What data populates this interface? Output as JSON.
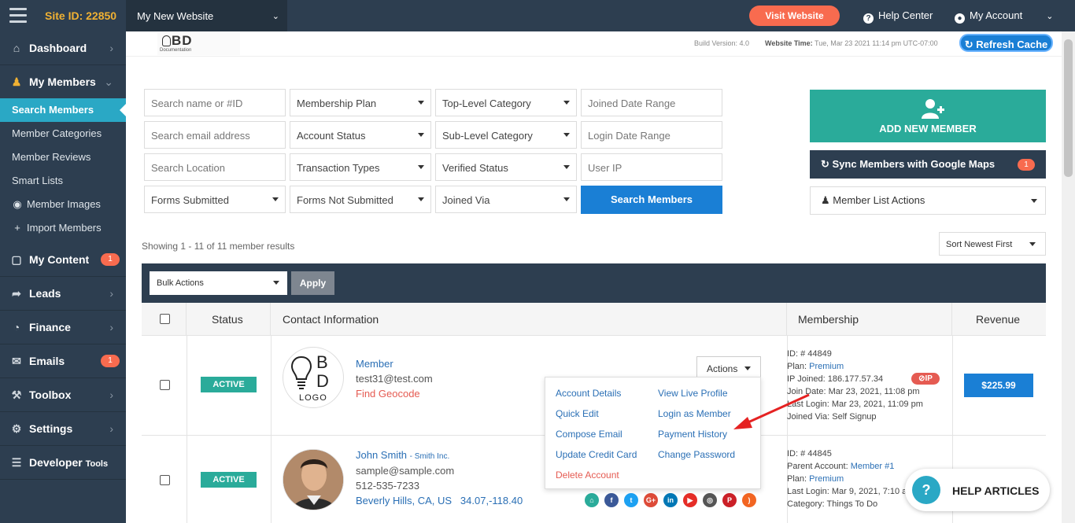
{
  "topbar": {
    "site_id": "Site ID: 22850",
    "site_select": "My New Website",
    "visit_label": "Visit Website",
    "help_label": "Help Center",
    "account_label": "My Account"
  },
  "subheader": {
    "logo_text": "BD",
    "logo_sub": "Documentation",
    "build_version": "Build Version: 4.0",
    "website_time_label": "Website Time:",
    "website_time_value": "Tue, Mar 23 2021 11:14 pm UTC-07:00",
    "refresh_label": "Refresh Cache"
  },
  "sidebar": {
    "dashboard": "Dashboard",
    "my_members": "My Members",
    "sub_items": [
      "Search Members",
      "Member Categories",
      "Member Reviews",
      "Smart Lists",
      "Member Images",
      "Import Members"
    ],
    "my_content": "My Content",
    "my_content_badge": "1",
    "leads": "Leads",
    "finance": "Finance",
    "emails": "Emails",
    "emails_badge": "1",
    "toolbox": "Toolbox",
    "settings": "Settings",
    "developer": "Developer",
    "developer_tools": "Tools"
  },
  "filters": {
    "search_name": "Search name or #ID",
    "membership_plan": "Membership Plan",
    "top_level_category": "Top-Level Category",
    "joined_date_range": "Joined Date Range",
    "search_email": "Search email address",
    "account_status": "Account Status",
    "sub_level_category": "Sub-Level Category",
    "login_date_range": "Login Date Range",
    "search_location": "Search Location",
    "transaction_types": "Transaction Types",
    "verified_status": "Verified Status",
    "user_ip": "User IP",
    "forms_submitted": "Forms Submitted",
    "forms_not_submitted": "Forms Not Submitted",
    "joined_via": "Joined Via",
    "search_button": "Search Members"
  },
  "right_panel": {
    "add_new_member": "ADD NEW MEMBER",
    "sync_label": "Sync Members with Google Maps",
    "sync_badge": "1",
    "list_actions": "Member List Actions"
  },
  "results": {
    "showing": "Showing 1 - 11 of 11 member results",
    "sort": "Sort Newest First",
    "bulk_actions": "Bulk Actions",
    "apply": "Apply"
  },
  "table": {
    "headers": {
      "status": "Status",
      "contact": "Contact Information",
      "membership": "Membership",
      "revenue": "Revenue"
    },
    "row1": {
      "status": "ACTIVE",
      "logo_line1": "B",
      "logo_line2": "D",
      "logo_line3": "LOGO",
      "name": "Member",
      "email": "test31@test.com",
      "geocode": "Find Geocode",
      "actions": "Actions",
      "id": "ID: # 44849",
      "plan_label": "Plan:",
      "plan_value": "Premium",
      "ip_joined": "IP Joined: 186.177.57.34",
      "ip_badge": "IP",
      "join_date": "Join Date: Mar 23, 2021, 11:08 pm",
      "last_login": "Last Login: Mar 23, 2021, 11:09 pm",
      "joined_via": "Joined Via: Self Signup",
      "revenue": "$225.99"
    },
    "row2": {
      "status": "ACTIVE",
      "name": "John Smith",
      "company": "- Smith Inc.",
      "email": "sample@sample.com",
      "phone": "512-535-7233",
      "location": "Beverly Hills, CA, US",
      "coords": "34.07,-118.40",
      "id": "ID: # 44845",
      "parent_label": "Parent Account:",
      "parent_value": "Member #1",
      "plan_label": "Plan:",
      "plan_value": "Premium",
      "last_login": "Last Login: Mar 9, 2021, 7:10 a",
      "category": "Category: Things To Do"
    }
  },
  "actions_menu": {
    "account_details": "Account Details",
    "view_live_profile": "View Live Profile",
    "quick_edit": "Quick Edit",
    "login_as_member": "Login as Member",
    "compose_email": "Compose Email",
    "payment_history": "Payment History",
    "update_credit_card": "Update Credit Card",
    "change_password": "Change Password",
    "delete_account": "Delete Account"
  },
  "social_icons": [
    {
      "name": "home-icon",
      "glyph": "⌂",
      "color": "#2aab9a"
    },
    {
      "name": "facebook-icon",
      "glyph": "f",
      "color": "#3b5998"
    },
    {
      "name": "twitter-icon",
      "glyph": "t",
      "color": "#1da1f2"
    },
    {
      "name": "google-plus-icon",
      "glyph": "G+",
      "color": "#dd4b39"
    },
    {
      "name": "linkedin-icon",
      "glyph": "in",
      "color": "#0077b5"
    },
    {
      "name": "youtube-icon",
      "glyph": "▶",
      "color": "#e52d27"
    },
    {
      "name": "instagram-icon",
      "glyph": "◎",
      "color": "#555555"
    },
    {
      "name": "pinterest-icon",
      "glyph": "P",
      "color": "#cb2027"
    },
    {
      "name": "rss-icon",
      "glyph": ")",
      "color": "#f26522"
    }
  ],
  "help_articles": "HELP ARTICLES",
  "colors": {
    "sidebar": "#2d3e50",
    "accent": "#2aab9a",
    "primary": "#1a7fd5",
    "danger": "#f86b4f",
    "active_nav": "#2aa8c5"
  }
}
